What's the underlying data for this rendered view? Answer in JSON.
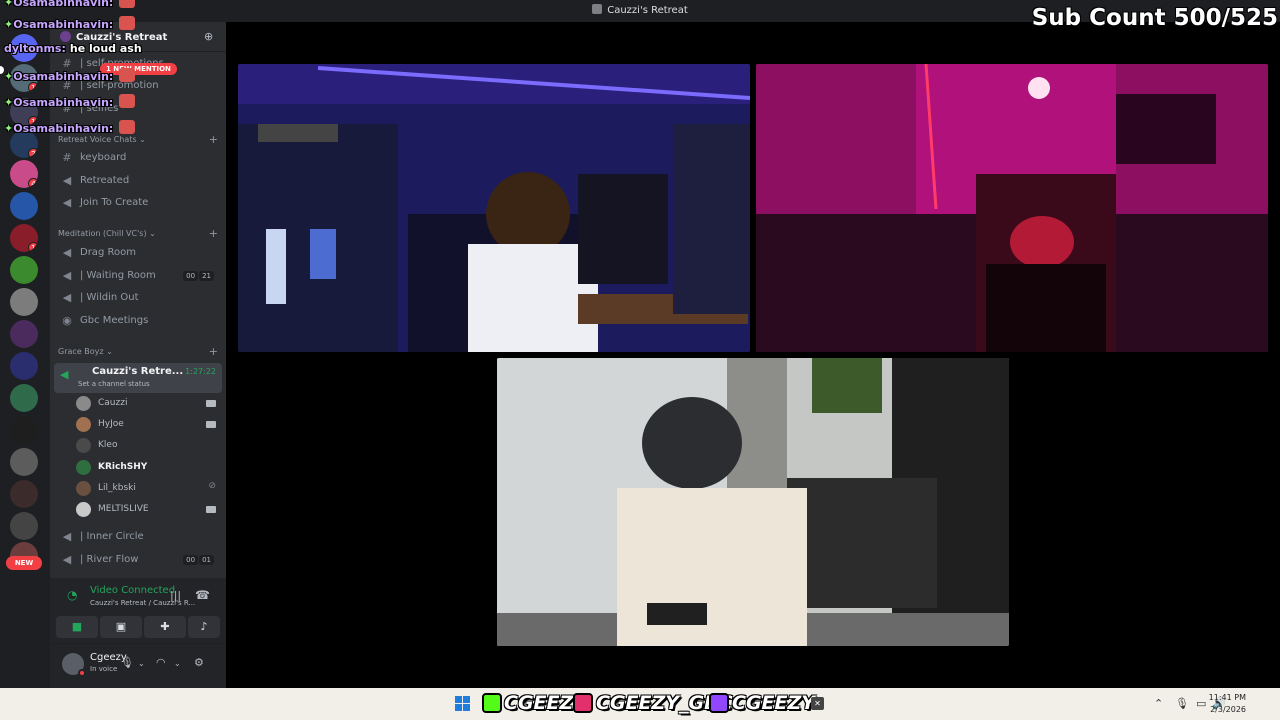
{
  "window": {
    "title": "Cauzzi's Retreat"
  },
  "overlay": {
    "sub_count": "Sub Count 500/525",
    "chat": [
      {
        "name": "Osamabinhavin:",
        "text": ""
      },
      {
        "name": "Osamabinhavin:",
        "text": ""
      },
      {
        "name": "dyltonms:",
        "text": "he loud ash"
      },
      {
        "name": "Osamabinhavin:",
        "text": ""
      },
      {
        "name": "Osamabinhavin:",
        "text": ""
      },
      {
        "name": "Osamabinhavin:",
        "text": ""
      }
    ]
  },
  "server_rail": {
    "new_label": "NEW",
    "badges": [
      "1",
      "1",
      "2",
      "4",
      "1"
    ]
  },
  "guild": {
    "name": "Cauzzi's Retreat",
    "channels_top": [
      {
        "label": "| self-promotions",
        "icon": "hash-icon"
      },
      {
        "label": "| self-promotion",
        "icon": "hash-icon"
      },
      {
        "label": "| selfies",
        "icon": "hash-icon"
      }
    ],
    "new_mention": "1 NEW MENTION",
    "cat_voice_chats": "Retreat Voice Chats",
    "voice_chats": [
      {
        "label": "keyboard",
        "icon": "hash-icon"
      },
      {
        "label": "Retreated",
        "icon": "speaker-icon"
      },
      {
        "label": "Join To Create",
        "icon": "speaker-icon"
      }
    ],
    "cat_meditation": "Meditation (Chill VC's)",
    "meditation": [
      {
        "label": "Drag Room",
        "icon": "speaker-icon"
      },
      {
        "label": "| Waiting Room",
        "icon": "speaker-icon",
        "c1": "00",
        "c2": "21"
      },
      {
        "label": "| Wildin Out",
        "icon": "speaker-icon"
      },
      {
        "label": "Gbc Meetings",
        "icon": "stage-icon"
      }
    ],
    "cat_grace": "Grace Boyz",
    "active_channel": {
      "name": "Cauzzi's Retre...",
      "status": "Set a channel status",
      "timer": "1:27:22"
    },
    "users": [
      {
        "name": "Cauzzi",
        "avatar": "#8a8a8a",
        "state": "camera"
      },
      {
        "name": "HyJoe",
        "avatar": "#a07050",
        "state": "camera"
      },
      {
        "name": "Kleo",
        "avatar": "#4a4a4a",
        "state": ""
      },
      {
        "name": "KRichSHY",
        "avatar": "#2f6f3f",
        "state": "",
        "bold": true
      },
      {
        "name": "Lil_kbski",
        "avatar": "#6a5040",
        "state": "muted"
      },
      {
        "name": "MELTISLIVE",
        "avatar": "#c9c9c9",
        "state": "camera"
      }
    ],
    "after_users": [
      {
        "label": "| Inner Circle",
        "icon": "speaker-icon"
      },
      {
        "label": "| River Flow",
        "icon": "speaker-icon",
        "c1": "00",
        "c2": "01"
      }
    ]
  },
  "voice_panel": {
    "status": "Video Connected",
    "location": "Cauzzi's Retreat / Cauzzi's R..."
  },
  "me": {
    "name": "Cgeezy",
    "status": "In voice"
  },
  "taskbar": {
    "kick": "CGEEZY",
    "instagram": "CGEEZY_GBC",
    "twitch": "CGEEZY",
    "time": "11:41 PM",
    "date": "2/3/2026",
    "colors": {
      "kick": "#53fc18",
      "instagram": "#e1306c",
      "twitch": "#9146ff"
    }
  },
  "video_tiles": [
    {
      "name": "tile-top-left",
      "palette": [
        "#1b1b5e",
        "#3b2fa8",
        "#0f0f2a"
      ]
    },
    {
      "name": "tile-top-right",
      "palette": [
        "#b0117a",
        "#4a0a3a",
        "#1a0510"
      ]
    },
    {
      "name": "tile-bottom",
      "palette": [
        "#cfd3d4",
        "#6f7070",
        "#2a2a2a"
      ]
    }
  ]
}
